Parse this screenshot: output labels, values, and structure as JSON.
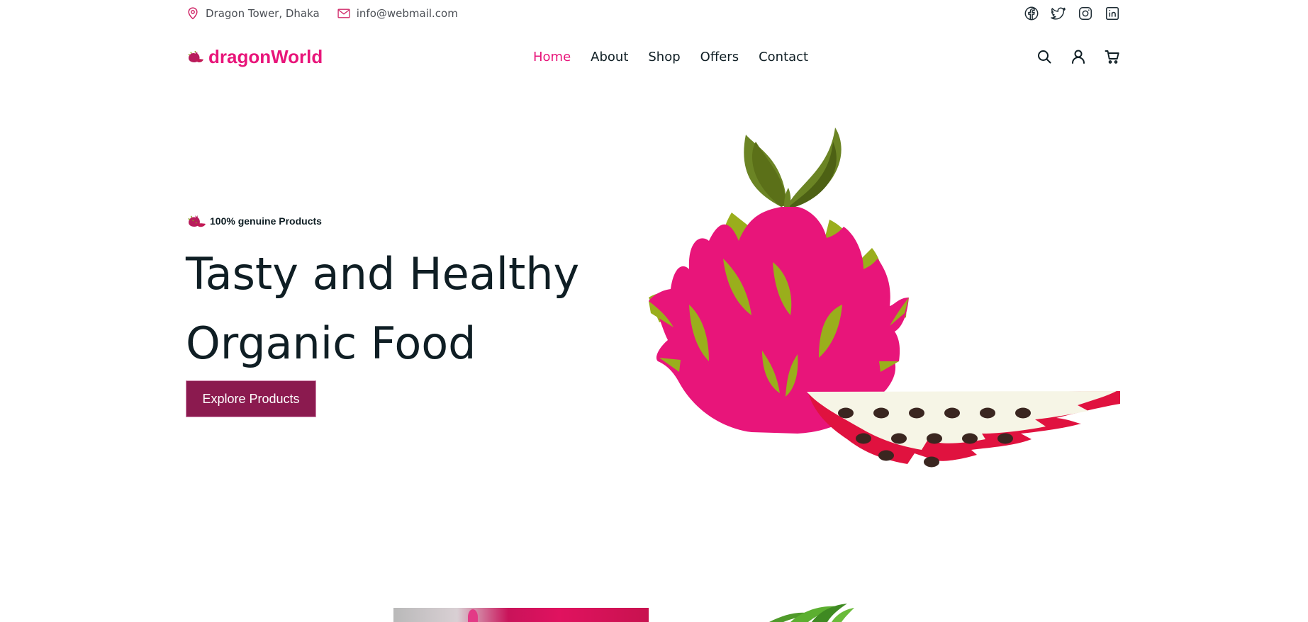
{
  "topbar": {
    "address": "Dragon Tower, Dhaka",
    "email": "info@webmail.com",
    "address_icon": "map-pin-icon",
    "email_icon": "mail-icon",
    "social": [
      "facebook-icon",
      "twitter-icon",
      "instagram-icon",
      "linkedin-icon"
    ]
  },
  "brand": {
    "name": "dragonWorld",
    "logo_icon": "dragon-fruit-logo-icon"
  },
  "nav": {
    "items": [
      {
        "label": "Home",
        "active": true
      },
      {
        "label": "About",
        "active": false
      },
      {
        "label": "Shop",
        "active": false
      },
      {
        "label": "Offers",
        "active": false
      },
      {
        "label": "Contact",
        "active": false
      }
    ],
    "icons": [
      "search-icon",
      "user-icon",
      "cart-icon"
    ]
  },
  "hero": {
    "tagline": "100% genuine Products",
    "title": "Tasty and Healthy\nOrganic Food",
    "button_label": "Explore Products",
    "illustration": "dragon-fruit-illustration"
  },
  "colors": {
    "brand_pink": "#e8157a",
    "button_bg": "#8b1a4f",
    "text_dark": "#0f1e24",
    "leaf_green": "#9aae1c",
    "stem_green": "#6b8424",
    "flesh_cream": "#f6f5e6",
    "seed_dark": "#3a2620",
    "rind_red": "#e0123f"
  }
}
